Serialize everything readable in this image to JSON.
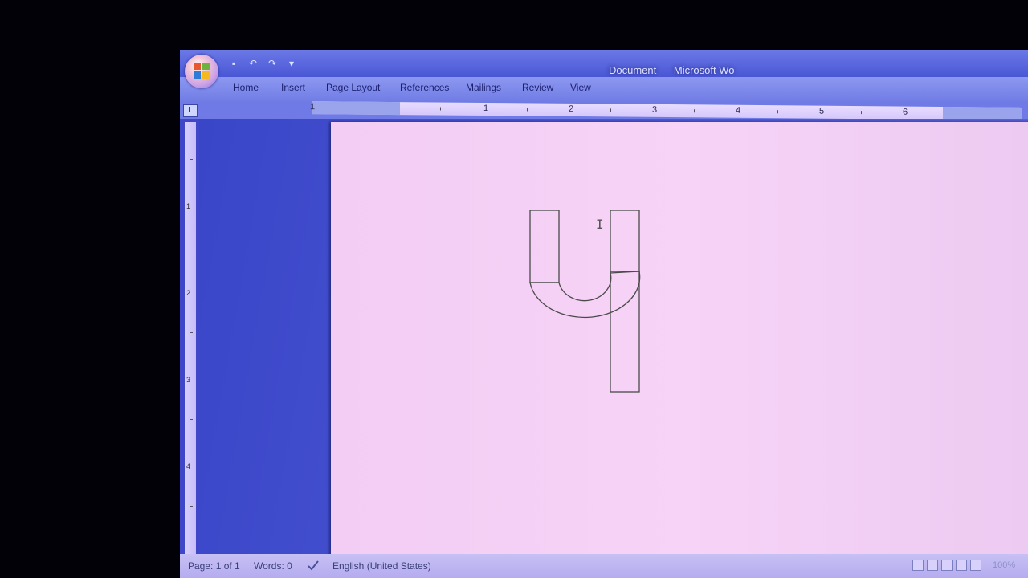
{
  "window": {
    "title_parts": [
      "Document",
      "Microsoft Wo"
    ]
  },
  "ribbon": {
    "tabs": [
      "Home",
      "Insert",
      "Page Layout",
      "References",
      "Mailings",
      "Review",
      "View"
    ]
  },
  "ruler": {
    "horizontal_numbers": [
      "1",
      "1",
      "2",
      "3",
      "4",
      "5",
      "6"
    ],
    "vertical_numbers": [
      "1",
      "2",
      "3",
      "4"
    ]
  },
  "document": {
    "content": "Shape resembling the letter ч (Cyrillic che) drawn with rectangles and an arc"
  },
  "statusbar": {
    "page": "Page: 1 of 1",
    "words": "Words: 0",
    "language": "English (United States)",
    "zoom": "100%"
  },
  "icons": [
    "office-logo-icon",
    "save-icon",
    "undo-icon",
    "redo-icon",
    "proofing-check-icon",
    "print-layout-icon",
    "full-screen-icon",
    "web-layout-icon",
    "outline-icon",
    "draft-icon"
  ],
  "colors": {
    "accent": "#4957d6",
    "page": "#f5d0f5"
  }
}
